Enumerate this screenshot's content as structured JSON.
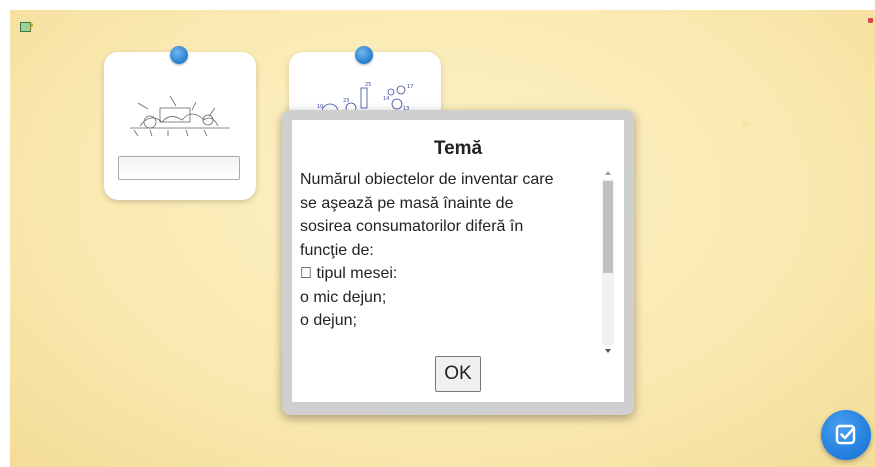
{
  "dialog": {
    "title": "Temă",
    "lines": [
      "Numărul obiectelor de inventar care",
      "se aşează pe masă înainte de",
      "sosirea consumatorilor diferă în",
      "funcţie de:",
      " tipul mesei:",
      "o mic dejun;",
      "o dejun;"
    ],
    "ok_label": "OK"
  },
  "cards": [
    {
      "icon": "equipment-sketch-icon",
      "input_value": ""
    },
    {
      "icon": "numbered-items-sketch-icon"
    }
  ],
  "colors": {
    "background": "#faeab2",
    "pin": "#2f86d4",
    "check_button": "#1f7ddc"
  }
}
